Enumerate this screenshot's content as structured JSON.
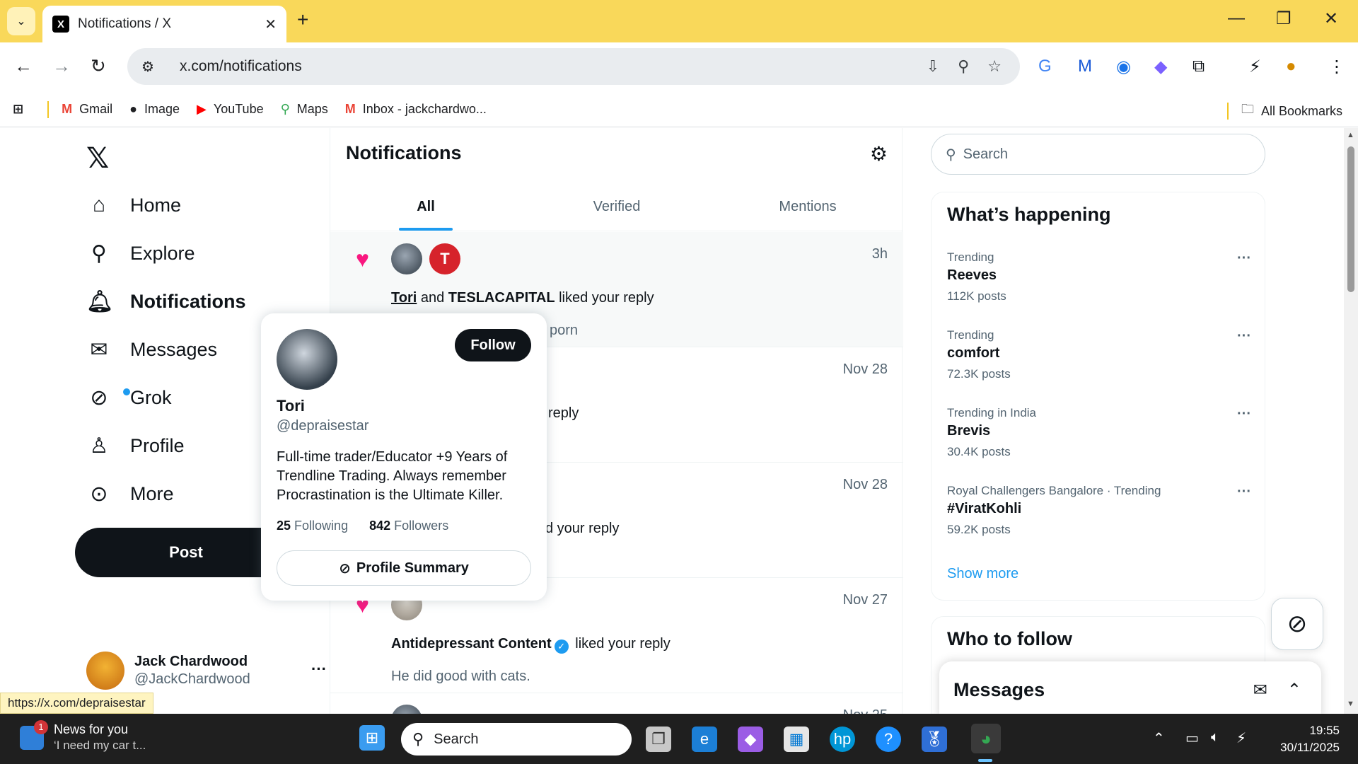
{
  "browser": {
    "tab_title": "Notifications / X",
    "tab_favicon": "X",
    "url": "x.com/notifications",
    "new_tab": "+",
    "bookmarks": [
      {
        "label": "Gmail",
        "icon": "M"
      },
      {
        "label": "Image",
        "icon": "●"
      },
      {
        "label": "YouTube",
        "icon": "▶"
      },
      {
        "label": "Maps",
        "icon": "⚲"
      },
      {
        "label": "Inbox - jackchardwo...",
        "icon": "M"
      }
    ],
    "all_bookmarks": "All Bookmarks"
  },
  "nav": {
    "logo": "𝕏",
    "items": [
      {
        "label": "Home",
        "icon": "home-icon"
      },
      {
        "label": "Explore",
        "icon": "search-icon"
      },
      {
        "label": "Notifications",
        "icon": "bell-icon"
      },
      {
        "label": "Messages",
        "icon": "envelope-icon"
      },
      {
        "label": "Grok",
        "icon": "grok-icon"
      },
      {
        "label": "Profile",
        "icon": "person-icon"
      },
      {
        "label": "More",
        "icon": "more-circle-icon"
      }
    ],
    "post_label": "Post",
    "user": {
      "name": "Jack Chardwood",
      "handle": "@JackChardwood"
    }
  },
  "main": {
    "title": "Notifications",
    "tabs": [
      "All",
      "Verified",
      "Mentions"
    ],
    "notifications": [
      {
        "time": "3h",
        "actor1": "Tori",
        "connector": "and",
        "actor2": "TESLACAPITAL",
        "action": "liked your reply",
        "snippet": "porn"
      },
      {
        "time": "Nov 28",
        "action": "reply"
      },
      {
        "time": "Nov 28",
        "action": "d your reply"
      },
      {
        "time": "Nov 27",
        "actor1": "Antidepressant Content",
        "action": "liked your reply",
        "snippet": "He did good with cats."
      },
      {
        "time": "Nov 25"
      }
    ]
  },
  "hovercard": {
    "follow": "Follow",
    "name": "Tori",
    "handle": "@depraisestar",
    "bio": "Full-time trader/Educator +9 Years of Trendline Trading. Always remember Procrastination is the Ultimate Killer.",
    "following_count": "25",
    "following_label": "Following",
    "followers_count": "842",
    "followers_label": "Followers",
    "profile_summary": "Profile Summary"
  },
  "sidebar": {
    "search_placeholder": "Search",
    "happening_title": "What’s happening",
    "trends": [
      {
        "context": "Trending",
        "name": "Reeves",
        "count": "112K posts"
      },
      {
        "context": "Trending",
        "name": "comfort",
        "count": "72.3K posts"
      },
      {
        "context": "Trending in India",
        "name": "Brevis",
        "count": "30.4K posts"
      },
      {
        "context": "Royal Challengers Bangalore · Trending",
        "name": "#ViratKohli",
        "count": "59.2K posts"
      }
    ],
    "show_more": "Show more",
    "who_to_follow": "Who to follow",
    "messages_title": "Messages"
  },
  "status_url": "https://x.com/depraisestar",
  "taskbar": {
    "news_title": "News for you",
    "news_sub": "‘I need my car t...",
    "news_badge": "1",
    "search": "Search",
    "time": "19:55",
    "date": "30/11/2025"
  },
  "colors": {
    "accent": "#1d9bf0",
    "like": "#f91880",
    "tabbar": "#f9d85a"
  }
}
